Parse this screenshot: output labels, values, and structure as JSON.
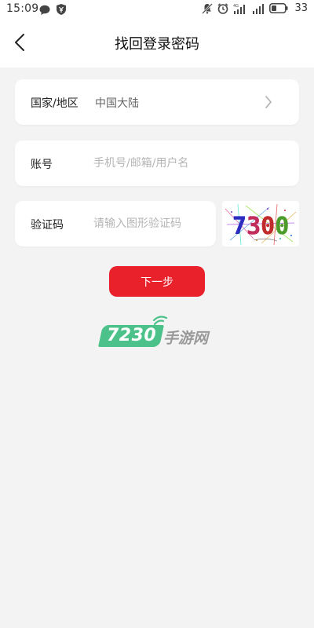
{
  "status_bar": {
    "time": "15:09",
    "battery_level": "33",
    "network_type": "4G"
  },
  "header": {
    "title": "找回登录密码"
  },
  "form": {
    "region": {
      "label": "国家/地区",
      "value": "中国大陆"
    },
    "account": {
      "label": "账号",
      "placeholder": "手机号/邮箱/用户名",
      "value": ""
    },
    "captcha": {
      "label": "验证码",
      "placeholder": "请输入图形验证码",
      "value": "",
      "image_text": "7300"
    },
    "next_button_label": "下一步"
  },
  "brand": {
    "number": "7230",
    "name": "手游网"
  },
  "colors": {
    "accent": "#e8212b",
    "brand_green": "#4cc28a",
    "background": "#f3f3f3"
  },
  "icons": {
    "back": "chevron-left-icon",
    "region_arrow": "chevron-right-icon"
  }
}
